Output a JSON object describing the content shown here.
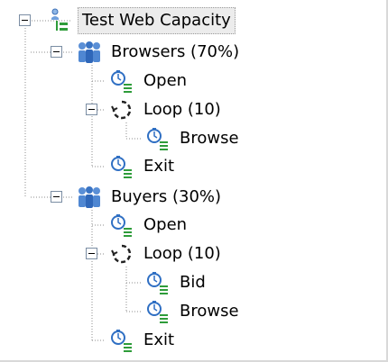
{
  "tree": {
    "root": {
      "label": "Test Web Capacity",
      "icon": "test-schedule-icon",
      "expanded": true,
      "selected": true
    },
    "groups": [
      {
        "label": "Browsers (70%)",
        "icon": "user-group-icon",
        "expanded": true,
        "children": [
          {
            "label": "Open",
            "icon": "timed-transaction-icon"
          },
          {
            "label": "Loop (10)",
            "icon": "loop-icon",
            "expanded": true,
            "children": [
              {
                "label": "Browse",
                "icon": "timed-transaction-icon"
              }
            ]
          },
          {
            "label": "Exit",
            "icon": "timed-transaction-icon"
          }
        ]
      },
      {
        "label": "Buyers (30%)",
        "icon": "user-group-icon",
        "expanded": true,
        "children": [
          {
            "label": "Open",
            "icon": "timed-transaction-icon"
          },
          {
            "label": "Loop (10)",
            "icon": "loop-icon",
            "expanded": true,
            "children": [
              {
                "label": "Bid",
                "icon": "timed-transaction-icon"
              },
              {
                "label": "Browse",
                "icon": "timed-transaction-icon"
              }
            ]
          },
          {
            "label": "Exit",
            "icon": "timed-transaction-icon"
          }
        ]
      }
    ]
  },
  "colors": {
    "line": "#8c8c8c",
    "selection": "#ececec",
    "toggle_border": "#7a8da3"
  }
}
